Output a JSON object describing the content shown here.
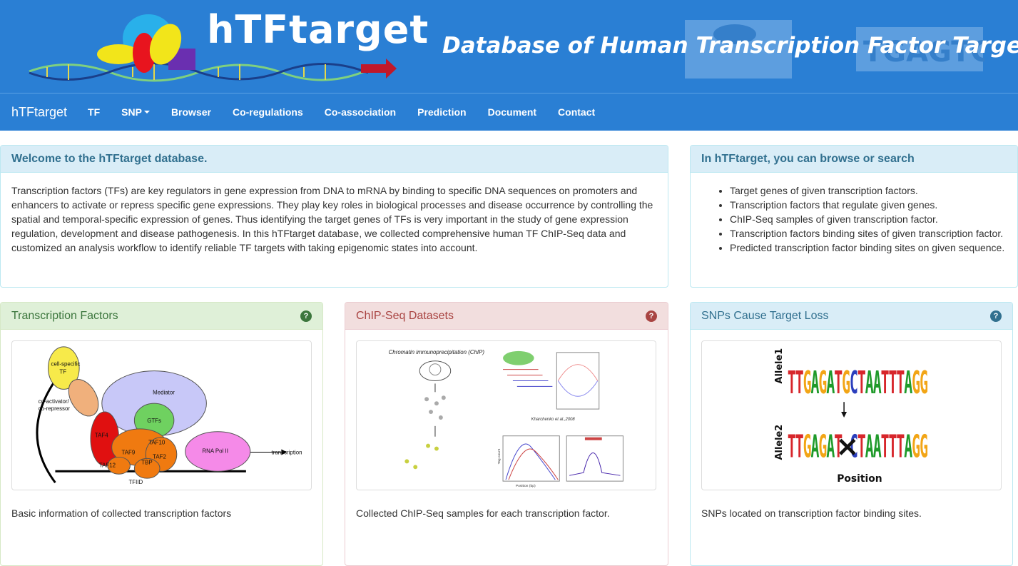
{
  "header": {
    "logo_title": "hTFtarget",
    "tagline": "Database of Human Transcription Factor Targets"
  },
  "nav": {
    "brand": "hTFtarget",
    "items": [
      "TF",
      "SNP",
      "Browser",
      "Co-regulations",
      "Co-association",
      "Prediction",
      "Document",
      "Contact"
    ]
  },
  "welcome": {
    "title": "Welcome to the hTFtarget database.",
    "body": "Transcription factors (TFs) are key regulators in gene expression from DNA to mRNA by binding to specific DNA sequences on promoters and enhancers to activate or repress specific gene expressions. They play key roles in biological processes and disease occurrence by controlling the spatial and temporal-specific expression of genes. Thus identifying the target genes of TFs is very important in the study of gene expression regulation, development and disease pathogenesis. In this hTFtarget database, we collected comprehensive human TF ChIP-Seq data and customized an analysis workflow to identify reliable TF targets with taking epigenomic states into account."
  },
  "browse": {
    "title": "In hTFtarget, you can browse or search",
    "items": [
      "Target genes of given transcription factors.",
      "Transcription factors that regulate given genes.",
      "ChIP-Seq samples of given transcription factor.",
      "Transcription factors binding sites of given transcription factor.",
      "Predicted transcription factor binding sites on given sequence."
    ]
  },
  "cards": [
    {
      "title": "Transcription Factors",
      "caption": "Basic information of collected transcription factors",
      "image_labels": [
        "cell-specific",
        "TF",
        "co-activator/",
        "co-repressor",
        "Mediator",
        "GTFs",
        "TAF4",
        "TAF10",
        "TAF9",
        "TAF2",
        "TAF12",
        "TBP",
        "RNA Pol II",
        "transcription",
        "TFIID"
      ]
    },
    {
      "title": "ChIP-Seq Datasets",
      "caption": "Collected ChIP-Seq samples for each transcription factor.",
      "image_labels": [
        "Chromatin immunoprecipitation (ChIP)",
        "Kharchenko et al.,2008",
        "Position (bp)",
        "Tag count"
      ]
    },
    {
      "title": "SNPs Cause Target Loss",
      "caption": "SNPs located on transcription factor binding sites.",
      "image_labels": [
        "Allele1",
        "Allele2",
        "Position"
      ],
      "logo_seq": "TTGAGATGCTAATTTAGG"
    }
  ],
  "colors": {
    "banner": "#2a7fd4",
    "info_heading": "#d9edf7",
    "success_heading": "#dff0d8",
    "danger_heading": "#f2dede"
  }
}
